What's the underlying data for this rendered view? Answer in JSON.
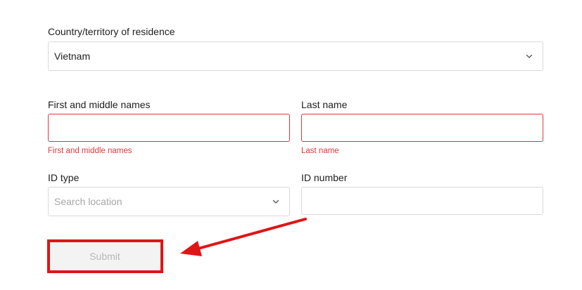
{
  "country": {
    "label": "Country/territory of residence",
    "value": "Vietnam"
  },
  "first_names": {
    "label": "First and middle names",
    "value": "",
    "error": "First and middle names"
  },
  "last_name": {
    "label": "Last name",
    "value": "",
    "error": "Last name"
  },
  "id_type": {
    "label": "ID type",
    "placeholder": "Search location"
  },
  "id_number": {
    "label": "ID number",
    "value": ""
  },
  "submit": {
    "label": "Submit"
  },
  "colors": {
    "error": "#d93a3a",
    "annotation": "#e01515",
    "disabled_text": "#b7b7b7"
  },
  "icons": [
    "chevron-down-icon",
    "annotation-arrow"
  ]
}
